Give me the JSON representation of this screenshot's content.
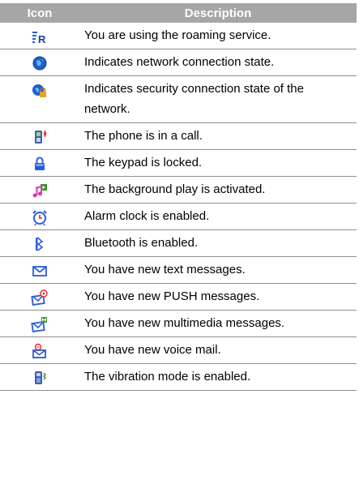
{
  "header": {
    "icon": "Icon",
    "description": "Description"
  },
  "rows": [
    {
      "icon": "roaming-icon",
      "description": "You are using the roaming service."
    },
    {
      "icon": "network-connection-icon",
      "description": "Indicates network connection state."
    },
    {
      "icon": "security-connection-icon",
      "description": "Indicates security connection state of the network."
    },
    {
      "icon": "in-call-icon",
      "description": "The phone is in a call."
    },
    {
      "icon": "keypad-lock-icon",
      "description": "The keypad is locked."
    },
    {
      "icon": "background-play-icon",
      "description": "The background play is activated."
    },
    {
      "icon": "alarm-clock-icon",
      "description": "Alarm clock is enabled."
    },
    {
      "icon": "bluetooth-icon",
      "description": "Bluetooth is enabled."
    },
    {
      "icon": "text-message-icon",
      "description": "You have new text messages."
    },
    {
      "icon": "push-message-icon",
      "description": "You have new PUSH messages."
    },
    {
      "icon": "multimedia-message-icon",
      "description": "You have new multimedia messages."
    },
    {
      "icon": "voice-mail-icon",
      "description": "You have new voice mail."
    },
    {
      "icon": "vibration-mode-icon",
      "description": "The vibration mode is enabled."
    }
  ]
}
